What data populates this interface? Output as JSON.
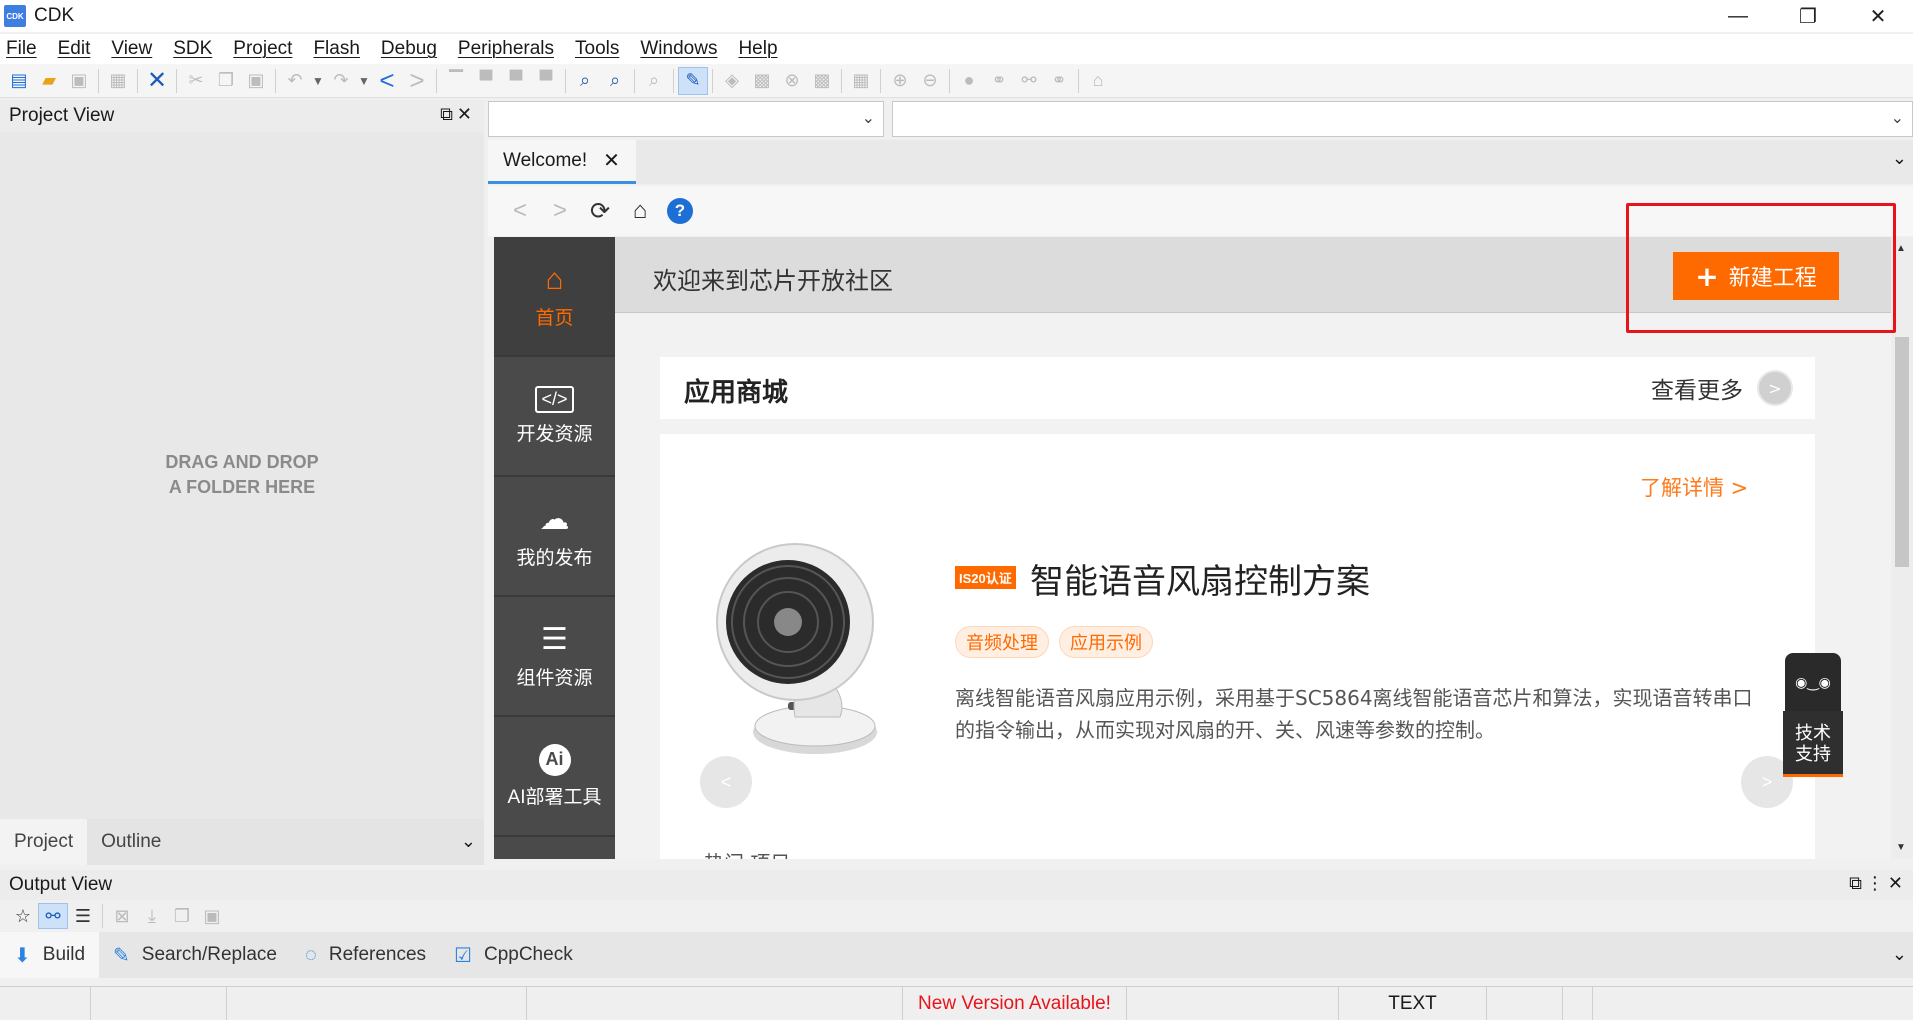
{
  "window": {
    "logo_text": "CDK",
    "title": "CDK",
    "min": "—",
    "restore": "❐",
    "close": "✕"
  },
  "menu": [
    "File",
    "Edit",
    "View",
    "SDK",
    "Project",
    "Flash",
    "Debug",
    "Peripherals",
    "Tools",
    "Windows",
    "Help"
  ],
  "project_view": {
    "title": "Project View",
    "controls": "⧉✕",
    "drop_line1": "DRAG AND DROP",
    "drop_line2": "A FOLDER HERE",
    "tabs": [
      "Project",
      "Outline"
    ],
    "tab_chevron": "⌄"
  },
  "editor": {
    "tab_label": "Welcome!",
    "tab_close": "✕",
    "nav_back": "<",
    "nav_forward": ">",
    "nav_refresh": "⟳",
    "nav_home": "⌂",
    "nav_help": "?",
    "chevron": "⌄"
  },
  "web": {
    "side_nav": [
      {
        "icon": "⌂",
        "label": "首页"
      },
      {
        "icon": "</>",
        "label": "开发资源"
      },
      {
        "icon": "☁",
        "label": "我的发布"
      },
      {
        "icon": "☰",
        "label": "组件资源"
      },
      {
        "icon": "Ai",
        "label": "AI部署工具"
      }
    ],
    "welcome_text": "欢迎来到芯片开放社区",
    "new_project_plus": "+",
    "new_project_label": "新建工程",
    "store_title": "应用商城",
    "more_label": "查看更多",
    "more_arrow": ">",
    "detail_link": "了解详情 >",
    "badge": "IS20认证",
    "product_title": "智能语音风扇控制方案",
    "tags": [
      "音频处理",
      "应用示例"
    ],
    "description": "离线智能语音风扇应用示例，采用基于SC5864离线智能语音芯片和算法，实现语音转串口的指令输出，从而实现对风扇的开、关、风速等参数的控制。",
    "prev": "<",
    "next": ">",
    "support_label_1": "技术",
    "support_label_2": "支持",
    "cut_text": "热门 项目"
  },
  "output_view": {
    "title": "Output View",
    "controls": "⧉⋮✕",
    "tabs": [
      {
        "icon": "⬇",
        "label": "Build"
      },
      {
        "icon": "✎",
        "label": "Search/Replace"
      },
      {
        "icon": "◌",
        "label": "References"
      },
      {
        "icon": "☑",
        "label": "CppCheck"
      }
    ],
    "chevron": "⌄"
  },
  "status": {
    "new_version": "New Version Available!",
    "mode": "TEXT"
  },
  "colors": {
    "accent": "#ff6a00",
    "highlight": "#e8141c",
    "link": "#1e6fd9"
  }
}
